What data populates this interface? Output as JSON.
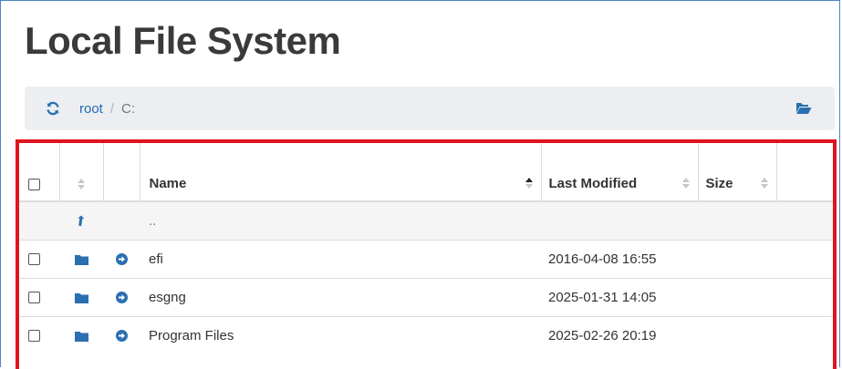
{
  "header": {
    "title": "Local File System"
  },
  "breadcrumb": {
    "root": "root",
    "separator": "/",
    "current": "C:"
  },
  "table": {
    "columns": {
      "name": "Name",
      "last_modified": "Last Modified",
      "size": "Size"
    },
    "parent_row": {
      "label": ".."
    },
    "rows": [
      {
        "name": "efi",
        "last_modified": "2016-04-08 16:55",
        "size": ""
      },
      {
        "name": "esgng",
        "last_modified": "2025-01-31 14:05",
        "size": ""
      },
      {
        "name": "Program Files",
        "last_modified": "2025-02-26 20:19",
        "size": ""
      }
    ]
  },
  "colors": {
    "link": "#1f6fb5",
    "highlight_border": "#e0141f",
    "breadcrumb_bg": "#eceef1"
  },
  "icons": [
    "refresh-icon",
    "folder-open-icon",
    "level-up-icon",
    "folder-icon",
    "arrow-circle-right-icon"
  ]
}
